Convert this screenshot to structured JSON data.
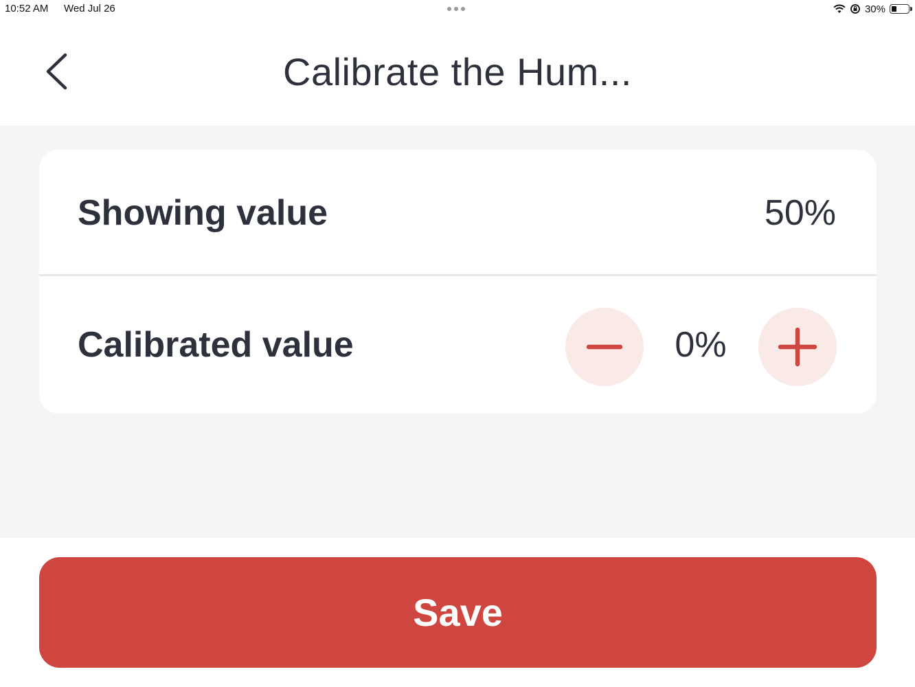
{
  "status_bar": {
    "time": "10:52 AM",
    "date": "Wed Jul 26",
    "battery_percent_text": "30%",
    "battery_level": 0.3
  },
  "nav": {
    "title": "Calibrate the Hum..."
  },
  "card": {
    "showing_label": "Showing value",
    "showing_value": "50%",
    "calibrated_label": "Calibrated value",
    "calibrated_value": "0%"
  },
  "footer": {
    "save_label": "Save"
  },
  "colors": {
    "accent": "#cf4640",
    "stepper_bg": "#f9e9e7",
    "text": "#2d313b",
    "background": "#f5f5f5"
  },
  "icons": {
    "back": "chevron-left-icon",
    "minus": "minus-icon",
    "plus": "plus-icon",
    "wifi": "wifi-icon",
    "orientation_lock": "orientation-lock-icon",
    "battery": "battery-icon",
    "multitasking": "ellipsis-icon"
  }
}
